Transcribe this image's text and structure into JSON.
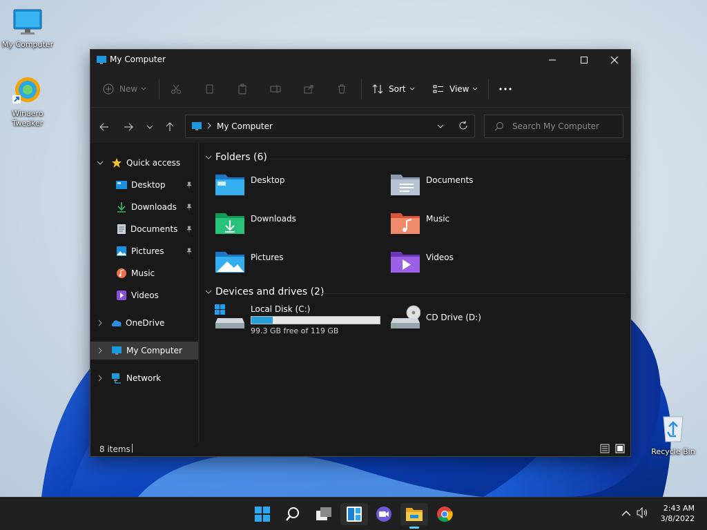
{
  "desktop": {
    "icons": [
      {
        "label": "My Computer",
        "icon": "monitor-icon"
      },
      {
        "label": "Winaero Tweaker",
        "icon": "winaero-icon"
      },
      {
        "label": "Recycle Bin",
        "icon": "recycle-bin-icon"
      }
    ]
  },
  "window": {
    "title": "My Computer",
    "controls": {
      "minimize": "minimize-icon",
      "maximize": "maximize-icon",
      "close": "close-icon"
    }
  },
  "toolbar": {
    "new_label": "New",
    "sort_label": "Sort",
    "view_label": "View",
    "more_icon": "more-icon",
    "disabled_actions": [
      "cut-icon",
      "copy-icon",
      "paste-icon",
      "rename-icon",
      "share-icon",
      "delete-icon"
    ]
  },
  "address": {
    "path": "My Computer",
    "search_placeholder": "Search My Computer"
  },
  "nav": {
    "quick_access": "Quick access",
    "items": [
      {
        "label": "Desktop",
        "icon": "desktop-folder-icon",
        "pinned": true
      },
      {
        "label": "Downloads",
        "icon": "download-icon",
        "pinned": true
      },
      {
        "label": "Documents",
        "icon": "document-icon",
        "pinned": true
      },
      {
        "label": "Pictures",
        "icon": "pictures-icon",
        "pinned": true
      },
      {
        "label": "Music",
        "icon": "music-icon",
        "pinned": false
      },
      {
        "label": "Videos",
        "icon": "videos-icon",
        "pinned": false
      }
    ],
    "onedrive": "OneDrive",
    "my_computer": "My Computer",
    "network": "Network"
  },
  "content": {
    "folders_header": "Folders (6)",
    "folders": [
      {
        "name": "Desktop",
        "icon": "desktop-folder-icon"
      },
      {
        "name": "Documents",
        "icon": "documents-folder-icon"
      },
      {
        "name": "Downloads",
        "icon": "downloads-folder-icon"
      },
      {
        "name": "Music",
        "icon": "music-folder-icon"
      },
      {
        "name": "Pictures",
        "icon": "pictures-folder-icon"
      },
      {
        "name": "Videos",
        "icon": "videos-folder-icon"
      }
    ],
    "drives_header": "Devices and drives (2)",
    "drives": [
      {
        "name": "Local Disk (C:)",
        "free_text": "99.3 GB free of 119 GB",
        "used_fraction": 0.166,
        "icon": "hard-drive-icon"
      },
      {
        "name": "CD Drive (D:)",
        "icon": "cd-drive-icon"
      }
    ]
  },
  "status": {
    "items": "8 items"
  },
  "taskbar": {
    "apps": [
      "start-icon",
      "search-icon",
      "task-view-icon",
      "widgets-icon",
      "chat-icon",
      "file-explorer-icon",
      "chrome-icon"
    ],
    "time": "2:43 AM",
    "date": "3/8/2022"
  },
  "colors": {
    "accent": "#0078d4",
    "drive_bar": "#26a0da",
    "folder_blue": "#1e90e0"
  }
}
